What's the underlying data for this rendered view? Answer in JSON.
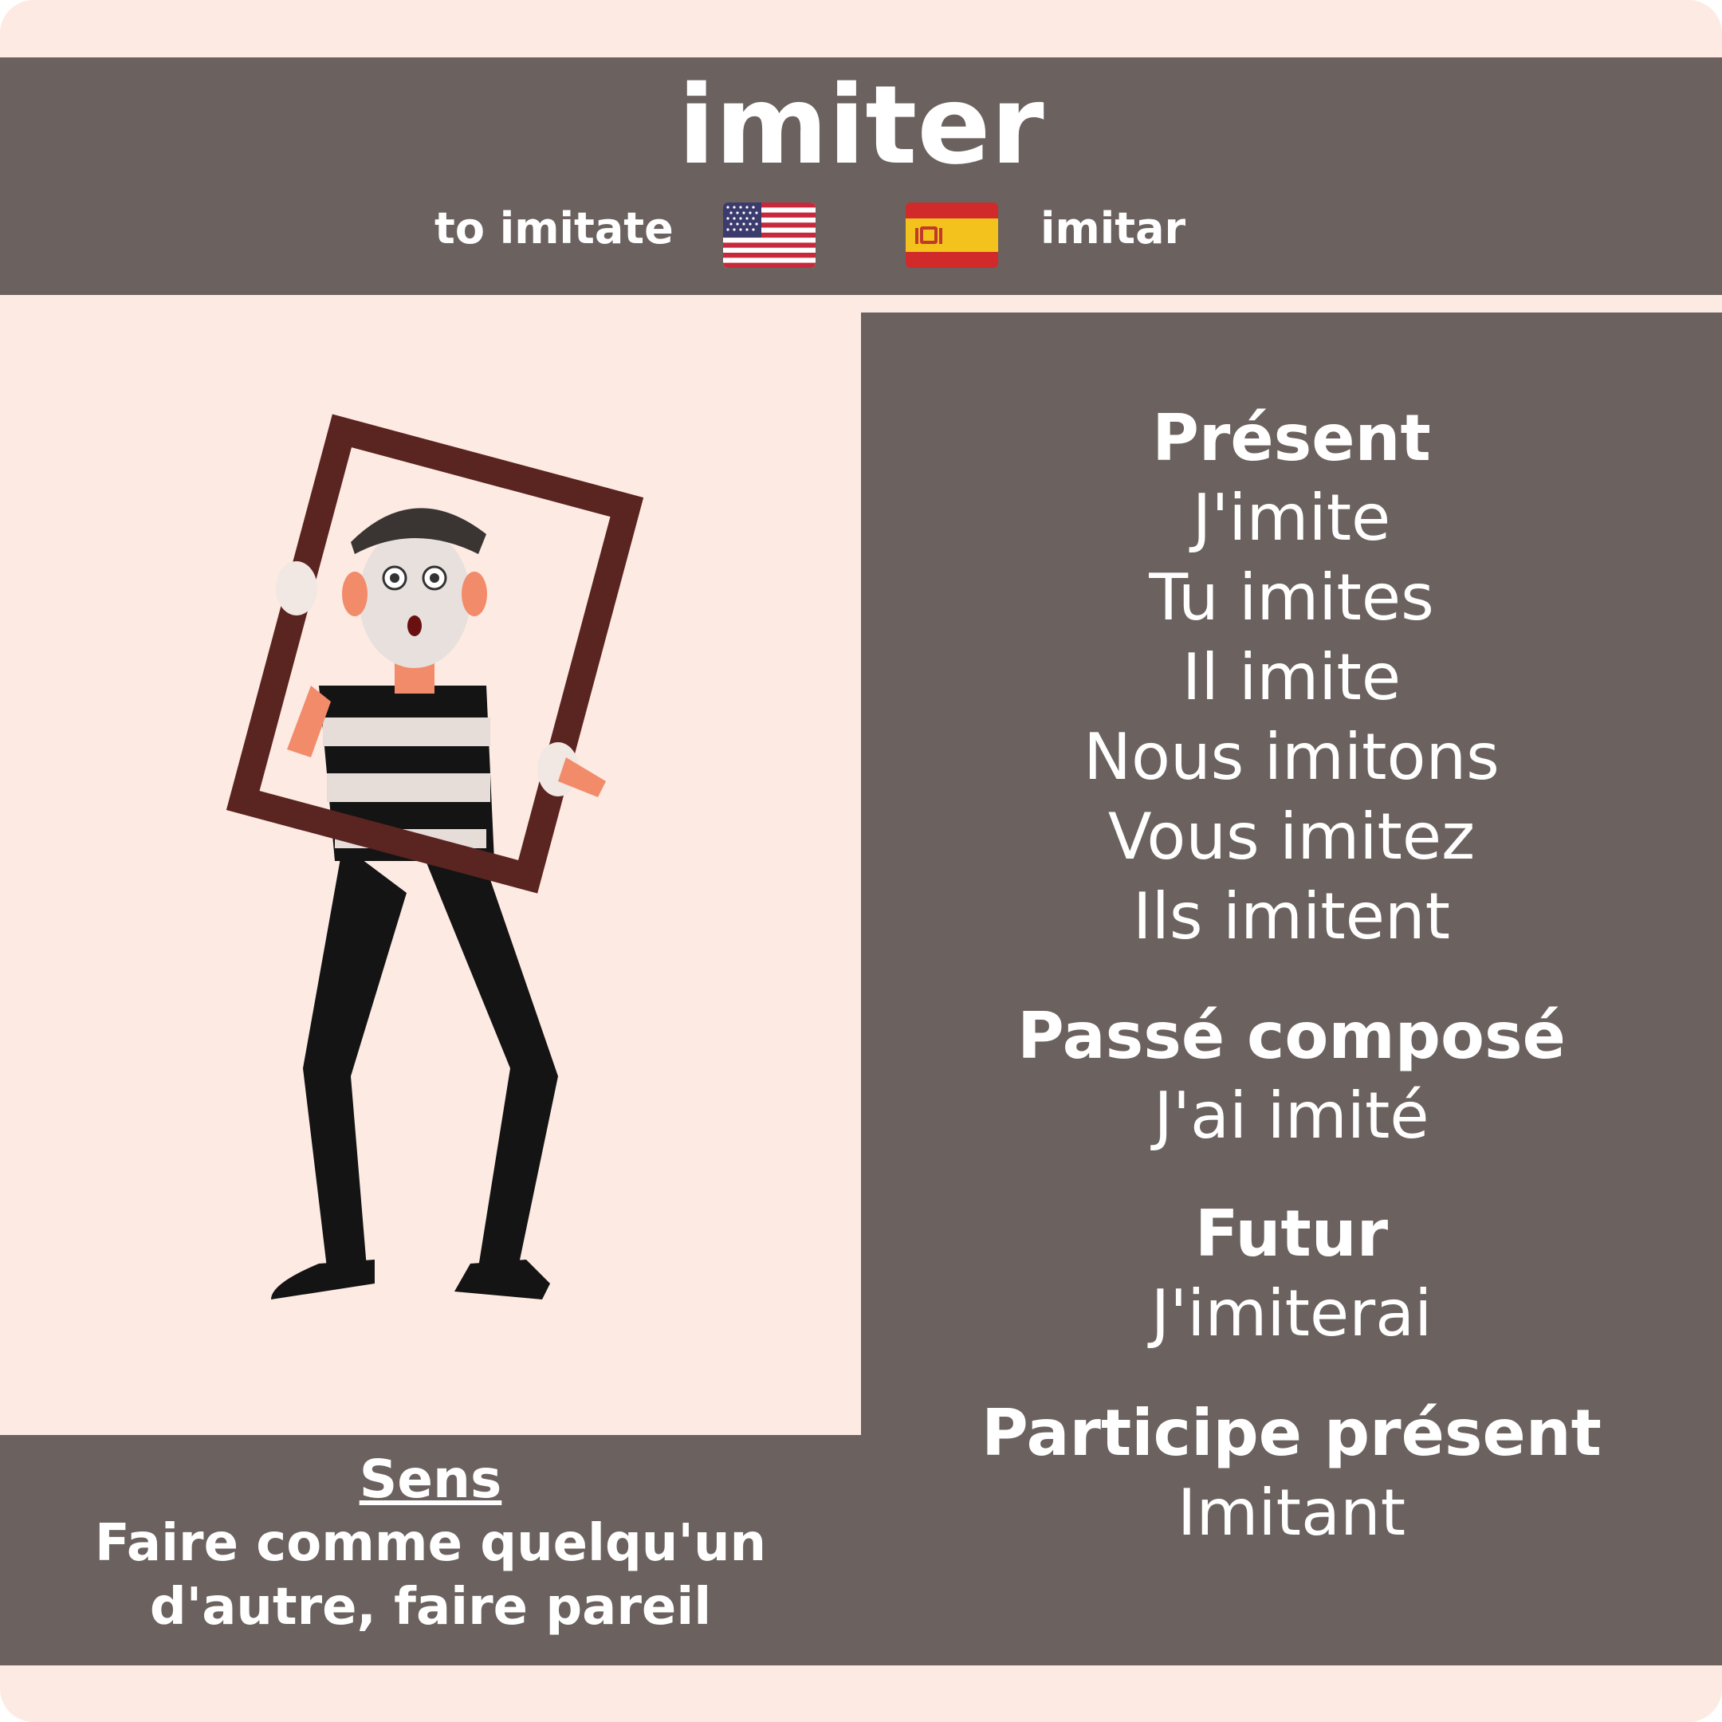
{
  "card": {
    "word": "imiter",
    "translations": {
      "english": "to imitate",
      "spanish": "imitar"
    },
    "flags": {
      "english": "us-flag-icon",
      "spanish": "spain-flag-icon"
    },
    "illustration": "mime-holding-frame-icon"
  },
  "conjugation": {
    "present": {
      "title": "Présent",
      "forms": [
        "J'imite",
        "Tu imites",
        "Il imite",
        "Nous imitons",
        "Vous imitez",
        "Ils imitent"
      ]
    },
    "passe_compose": {
      "title": "Passé composé",
      "forms": [
        "J'ai imité"
      ]
    },
    "futur": {
      "title": "Futur",
      "forms": [
        "J'imiterai"
      ]
    },
    "participe_present": {
      "title": "Participe présent",
      "forms": [
        "Imitant"
      ]
    }
  },
  "sens": {
    "title": "Sens",
    "line1": "Faire comme quelqu'un",
    "line2": "d'autre, faire pareil"
  },
  "colors": {
    "background": "#fdeae3",
    "panel": "#6b625f",
    "text": "#ffffff"
  }
}
